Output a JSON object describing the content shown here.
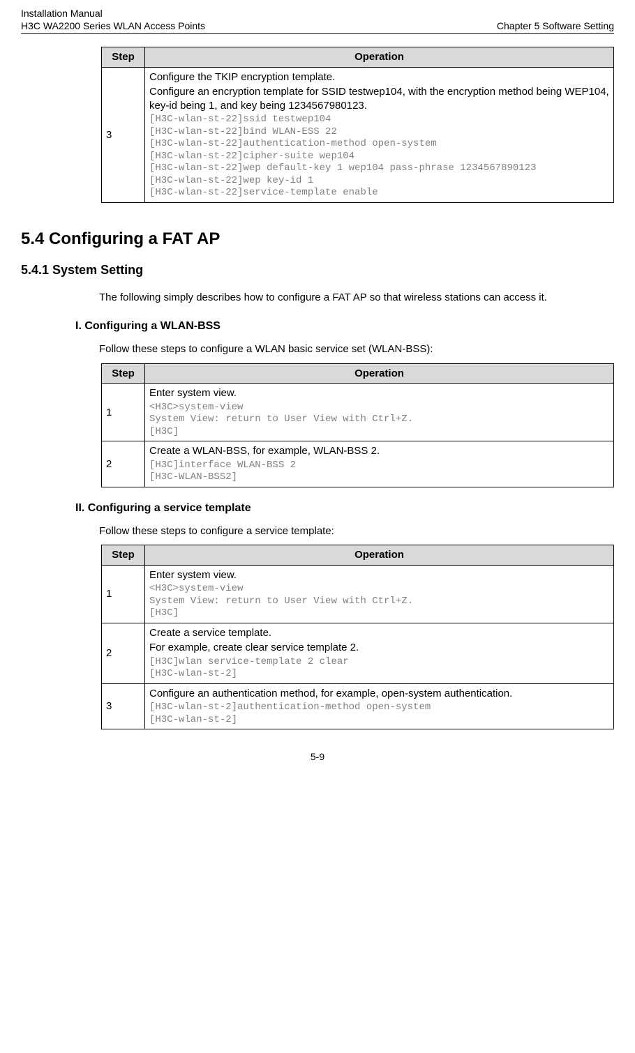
{
  "header": {
    "line1_left": "Installation Manual",
    "line2_left": "H3C WA2200 Series WLAN Access Points",
    "right": "Chapter 5  Software Setting"
  },
  "table1": {
    "head_step": "Step",
    "head_op": "Operation",
    "rows": [
      {
        "step": "3",
        "desc1": "Configure the TKIP encryption template.",
        "desc2": "Configure an encryption template for SSID testwep104, with the encryption method being WEP104, key-id being 1, and key being 1234567980123.",
        "code": "[H3C-wlan-st-22]ssid testwep104\n[H3C-wlan-st-22]bind WLAN-ESS 22\n[H3C-wlan-st-22]authentication-method open-system\n[H3C-wlan-st-22]cipher-suite wep104\n[H3C-wlan-st-22]wep default-key 1 wep104 pass-phrase 1234567890123\n[H3C-wlan-st-22]wep key-id 1\n[H3C-wlan-st-22]service-template enable"
      }
    ]
  },
  "section_5_4": "5.4  Configuring a FAT AP",
  "section_5_4_1": "5.4.1  System Setting",
  "para_5_4_1": "The following simply describes how to configure a FAT AP so that wireless stations can access it.",
  "sub_I_title": "I. Configuring a WLAN-BSS",
  "sub_I_intro": "Follow these steps to configure a WLAN basic service set (WLAN-BSS):",
  "table2": {
    "head_step": "Step",
    "head_op": "Operation",
    "rows": [
      {
        "step": "1",
        "desc1": "Enter system view.",
        "code": "<H3C>system-view\nSystem View: return to User View with Ctrl+Z.\n[H3C]"
      },
      {
        "step": "2",
        "desc1": "Create a WLAN-BSS, for example, WLAN-BSS 2.",
        "code": "[H3C]interface WLAN-BSS 2\n[H3C-WLAN-BSS2]"
      }
    ]
  },
  "sub_II_title": "II. Configuring a service template",
  "sub_II_intro": "Follow these steps to configure a service template:",
  "table3": {
    "head_step": "Step",
    "head_op": "Operation",
    "rows": [
      {
        "step": "1",
        "desc1": "Enter system view.",
        "code": "<H3C>system-view\nSystem View: return to User View with Ctrl+Z.\n[H3C]"
      },
      {
        "step": "2",
        "desc1": "Create a service template.",
        "desc2": "For example, create clear service template 2.",
        "code": "[H3C]wlan service-template 2 clear\n[H3C-wlan-st-2]"
      },
      {
        "step": "3",
        "desc1": "Configure an authentication method, for example, open-system authentication.",
        "code": "[H3C-wlan-st-2]authentication-method open-system\n[H3C-wlan-st-2]"
      }
    ]
  },
  "page_number": "5-9"
}
